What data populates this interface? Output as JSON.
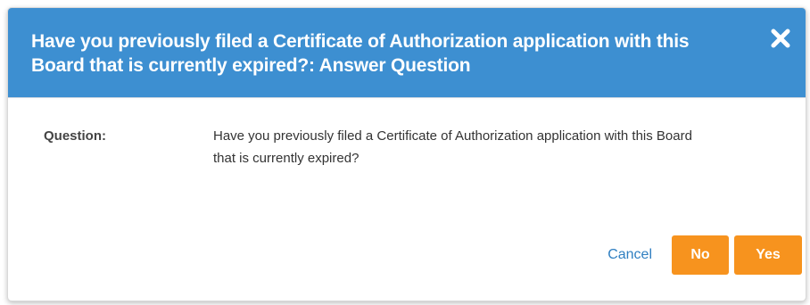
{
  "dialog": {
    "title": "Have you previously filed a Certificate of Authorization application with this Board that is currently expired?: Answer Question",
    "question_label": "Question:",
    "question_text": "Have you previously filed a Certificate of Authorization application with this Board that is currently expired?",
    "close_icon": "close-icon",
    "cancel_label": "Cancel",
    "no_label": "No",
    "yes_label": "Yes"
  },
  "colors": {
    "header_bg": "#3d8fd1",
    "button_bg": "#f7931e",
    "link": "#2f7fc1"
  }
}
